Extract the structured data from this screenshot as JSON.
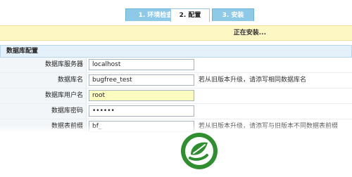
{
  "tabs": [
    {
      "label": "1. 环境检查"
    },
    {
      "label": "2. 配置"
    },
    {
      "label": "3. 安装"
    }
  ],
  "notice": {
    "text": "正在安装..."
  },
  "section": {
    "title": "数据库配置"
  },
  "fields": [
    {
      "label": "数据库服务器",
      "value": "localhost",
      "hint": ""
    },
    {
      "label": "数据库名",
      "value": "bugfree_test",
      "hint": "若从旧版本升级，请添写相同数据库名"
    },
    {
      "label": "数据库用户名",
      "value": "root",
      "hint": ""
    },
    {
      "label": "数据库密码",
      "value": "••••••",
      "hint": ""
    },
    {
      "label": "数据表前缀",
      "value": "bf_",
      "hint": "若从旧版本升级，请添写与旧版本不同数据表前缀"
    }
  ],
  "colors": {
    "tab_active": "#8ec9e8",
    "notice_bg": "#fdf7c4",
    "logo_green": "#2f8f2f"
  },
  "icons": {
    "logo": "leaf-logo-icon"
  }
}
